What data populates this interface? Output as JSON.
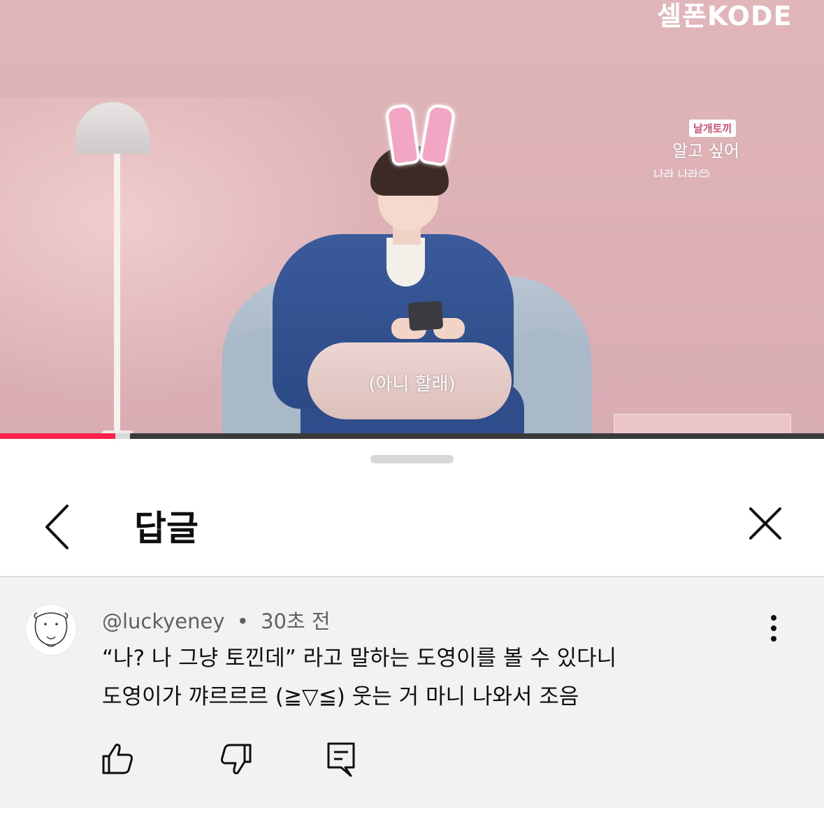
{
  "video": {
    "channel_logo": "셀폰KODE",
    "caption_tag": "날개토끼",
    "caption_main": "알고 싶어",
    "caption_partial": "나라 나라😊",
    "subtitle": "(아니 할래)",
    "progress": 0.14,
    "buffered": 0.158,
    "colors": {
      "progress": "#ff1f4b",
      "wall": "#dcb1b6"
    }
  },
  "sheet": {
    "title": "답글",
    "back_icon": "chevron-left-icon",
    "close_icon": "close-icon"
  },
  "comment": {
    "author": "@luckyeney",
    "separator": "•",
    "time": "30초 전",
    "text_line1": "“나? 나 그냥 토낀데” 라고 말하는 도영이를 볼 수 있다니",
    "text_line2": "도영이가 꺄르르르 (≧▽≦) 웃는 거 마니 나와서 조음",
    "avatar_icon": "sheep-avatar-icon",
    "actions": [
      "thumbs-up-icon",
      "thumbs-down-icon",
      "reply-icon"
    ],
    "menu_icon": "more-vertical-icon"
  }
}
